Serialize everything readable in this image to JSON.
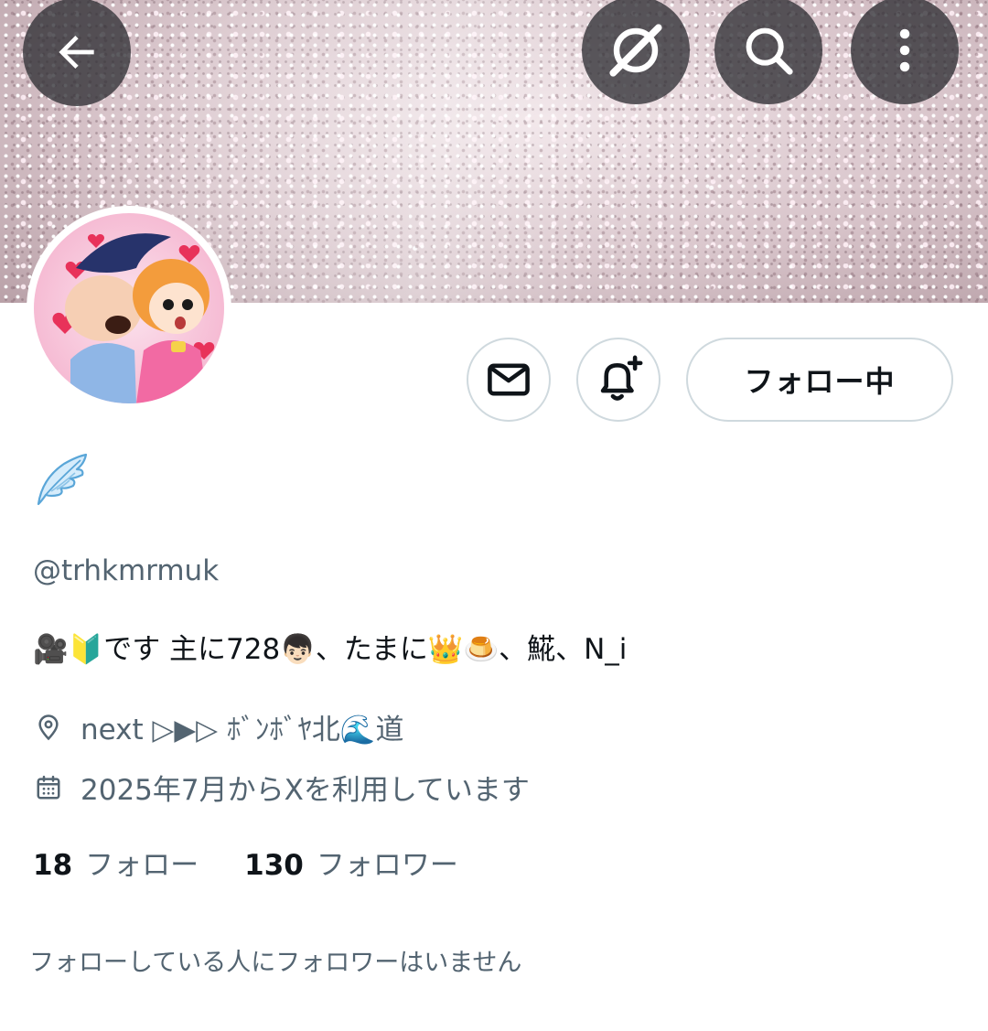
{
  "banner": {
    "back_icon": "arrow-left-icon",
    "grok_icon": "grok-icon",
    "search_icon": "search-icon",
    "more_icon": "more-vertical-icon"
  },
  "profile": {
    "display_name_icon": "wing-emoji",
    "handle": "@trhkmrmuk",
    "bio": "🎥🔰です 主に728👦🏻、たまに👑🍮、𩸽、N_i",
    "location": "next ▷▶▷ ﾎﾞﾝﾎﾞﾔ北🌊道",
    "joined": "2025年7月からXを利用しています"
  },
  "actions": {
    "message_icon": "mail-icon",
    "notify_icon": "bell-plus-icon",
    "following_label": "フォロー中"
  },
  "stats": {
    "following_count": "18",
    "following_label": "フォロー",
    "followers_count": "130",
    "followers_label": "フォロワー"
  },
  "followers_you_know": "フォローしている人にフォロワーはいません",
  "colors": {
    "text_primary": "#0f1419",
    "text_secondary": "#536471",
    "border": "#cfd9de",
    "overlay_button": "#303034"
  }
}
